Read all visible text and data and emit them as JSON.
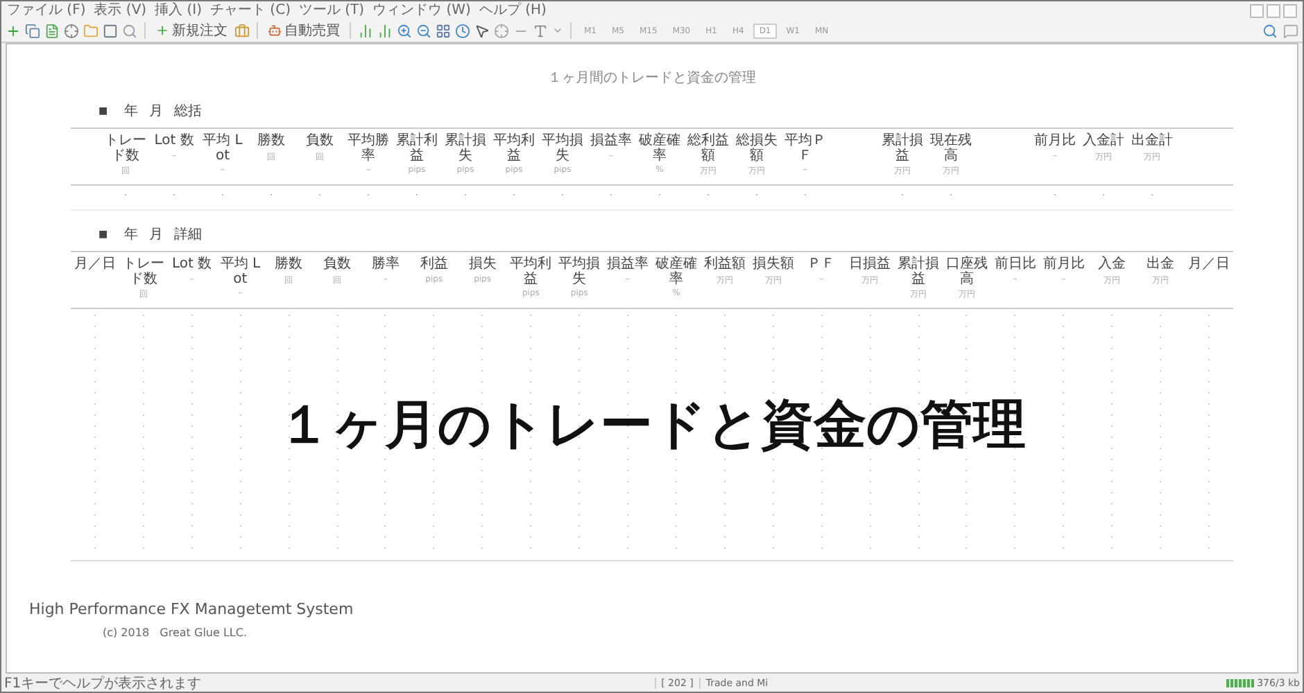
{
  "menu": [
    "ファイル (F)",
    "表示 (V)",
    "挿入 (I)",
    "チャート (C)",
    "ツール (T)",
    "ウィンドウ (W)",
    "ヘルプ (H)"
  ],
  "toolbar": {
    "buttons": [
      {
        "label": "新規注文"
      },
      {
        "label": "自動売買"
      }
    ],
    "timeframes": [
      {
        "label": "M1",
        "selected": false
      },
      {
        "label": "M5",
        "selected": false
      },
      {
        "label": "M15",
        "selected": false
      },
      {
        "label": "M30",
        "selected": false
      },
      {
        "label": "H1",
        "selected": false
      },
      {
        "label": "H4",
        "selected": false
      },
      {
        "label": "D1",
        "selected": true
      },
      {
        "label": "W1",
        "selected": false
      },
      {
        "label": "MN",
        "selected": false
      }
    ]
  },
  "page_title": "１ヶ月間のトレードと資金の管理",
  "summary": {
    "heading": [
      "■",
      "年",
      "月",
      "総括"
    ],
    "columns": [
      {
        "label": "トレード数",
        "unit": "回"
      },
      {
        "label": "Lot 数",
        "unit": "–"
      },
      {
        "label": "平均 Lot",
        "unit": "–"
      },
      {
        "label": "勝数",
        "unit": "回"
      },
      {
        "label": "負数",
        "unit": "回"
      },
      {
        "label": "平均勝率",
        "unit": "–"
      },
      {
        "label": "累計利益",
        "unit": "pips"
      },
      {
        "label": "累計損失",
        "unit": "pips"
      },
      {
        "label": "平均利益",
        "unit": "pips"
      },
      {
        "label": "平均損失",
        "unit": "pips"
      },
      {
        "label": "損益率",
        "unit": "–"
      },
      {
        "label": "破産確率",
        "unit": "%"
      },
      {
        "label": "総利益額",
        "unit": "万円"
      },
      {
        "label": "総損失額",
        "unit": "万円"
      },
      {
        "label": "平均ＰＦ",
        "unit": "–"
      },
      {
        "label": "累計損益",
        "unit": "万円"
      },
      {
        "label": "現在残高",
        "unit": "万円"
      },
      {
        "label": "前月比",
        "unit": "–"
      },
      {
        "label": "入金計",
        "unit": "万円"
      },
      {
        "label": "出金計",
        "unit": "万円"
      }
    ]
  },
  "detail": {
    "heading": [
      "■",
      "年",
      "月",
      "詳細"
    ],
    "columns": [
      {
        "label": "月／日"
      },
      {
        "label": "トレード数",
        "unit": "回"
      },
      {
        "label": "Lot 数",
        "unit": "–"
      },
      {
        "label": "平均 Lot",
        "unit": "–"
      },
      {
        "label": "勝数",
        "unit": "回"
      },
      {
        "label": "負数",
        "unit": "回"
      },
      {
        "label": "勝率",
        "unit": "–"
      },
      {
        "label": "利益",
        "unit": "pips"
      },
      {
        "label": "損失",
        "unit": "pips"
      },
      {
        "label": "平均利益",
        "unit": "pips"
      },
      {
        "label": "平均損失",
        "unit": "pips"
      },
      {
        "label": "損益率",
        "unit": "–"
      },
      {
        "label": "破産確率",
        "unit": "%"
      },
      {
        "label": "利益額",
        "unit": "万円"
      },
      {
        "label": "損失額",
        "unit": "万円"
      },
      {
        "label": "ＰＦ",
        "unit": "–"
      },
      {
        "label": "日損益",
        "unit": "万円"
      },
      {
        "label": "累計損益",
        "unit": "万円"
      },
      {
        "label": "口座残高",
        "unit": "万円"
      },
      {
        "label": "前日比",
        "unit": "–"
      },
      {
        "label": "前月比",
        "unit": "–"
      },
      {
        "label": "入金",
        "unit": "万円"
      },
      {
        "label": "出金",
        "unit": "万円"
      },
      {
        "label": "月／日"
      }
    ]
  },
  "overlay_title": "１ヶ月のトレードと資金の管理",
  "footer": {
    "system": "High Performance FX Managetemt System",
    "copyright": "(c) 2018   Great Glue LLC."
  },
  "status_bar": {
    "hint": "F1キーでヘルプが表示されます",
    "count": "[ 202 ]",
    "profile": "Trade and Mi",
    "traffic": "376/3 kb"
  }
}
